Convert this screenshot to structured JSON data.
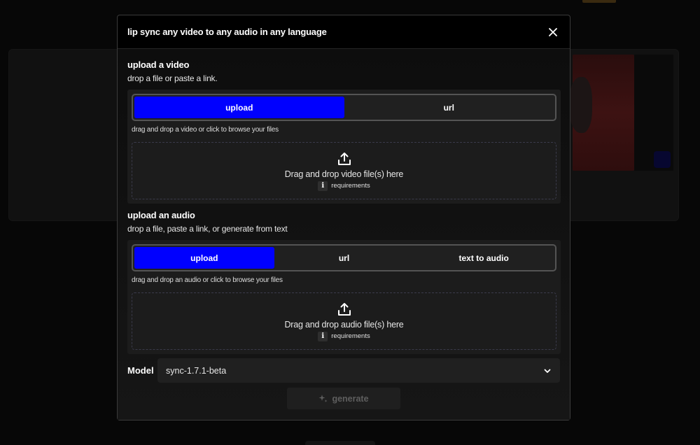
{
  "modal": {
    "title": "lip sync any video to any audio in any language"
  },
  "video_section": {
    "title": "upload a video",
    "subtitle": "drop a file or paste a link.",
    "tabs": [
      {
        "label": "upload",
        "active": true
      },
      {
        "label": "url",
        "active": false
      }
    ],
    "hint": "drag and drop a video or click to browse your files",
    "dropzone_text": "Drag and drop video file(s) here",
    "requirements_label": "requirements"
  },
  "audio_section": {
    "title": "upload an audio",
    "subtitle": "drop a file, paste a link, or generate from text",
    "tabs": [
      {
        "label": "upload",
        "active": true
      },
      {
        "label": "url",
        "active": false
      },
      {
        "label": "text to audio",
        "active": false
      }
    ],
    "hint": "drag and drop an audio or click to browse your files",
    "dropzone_text": "Drag and drop audio file(s) here",
    "requirements_label": "requirements"
  },
  "model": {
    "label": "Model",
    "selected": "sync-1.7.1-beta"
  },
  "generate": {
    "label": "generate",
    "disabled": true
  },
  "info_glyph": "i",
  "colors": {
    "accent": "#0000ff",
    "modal_bg": "#000000",
    "panel_bg": "#1c1c1c"
  },
  "icons": {
    "close": "close-icon",
    "upload": "upload-icon",
    "info": "info-icon",
    "chevron": "chevron-down-icon",
    "sparkle": "sparkle-icon"
  }
}
